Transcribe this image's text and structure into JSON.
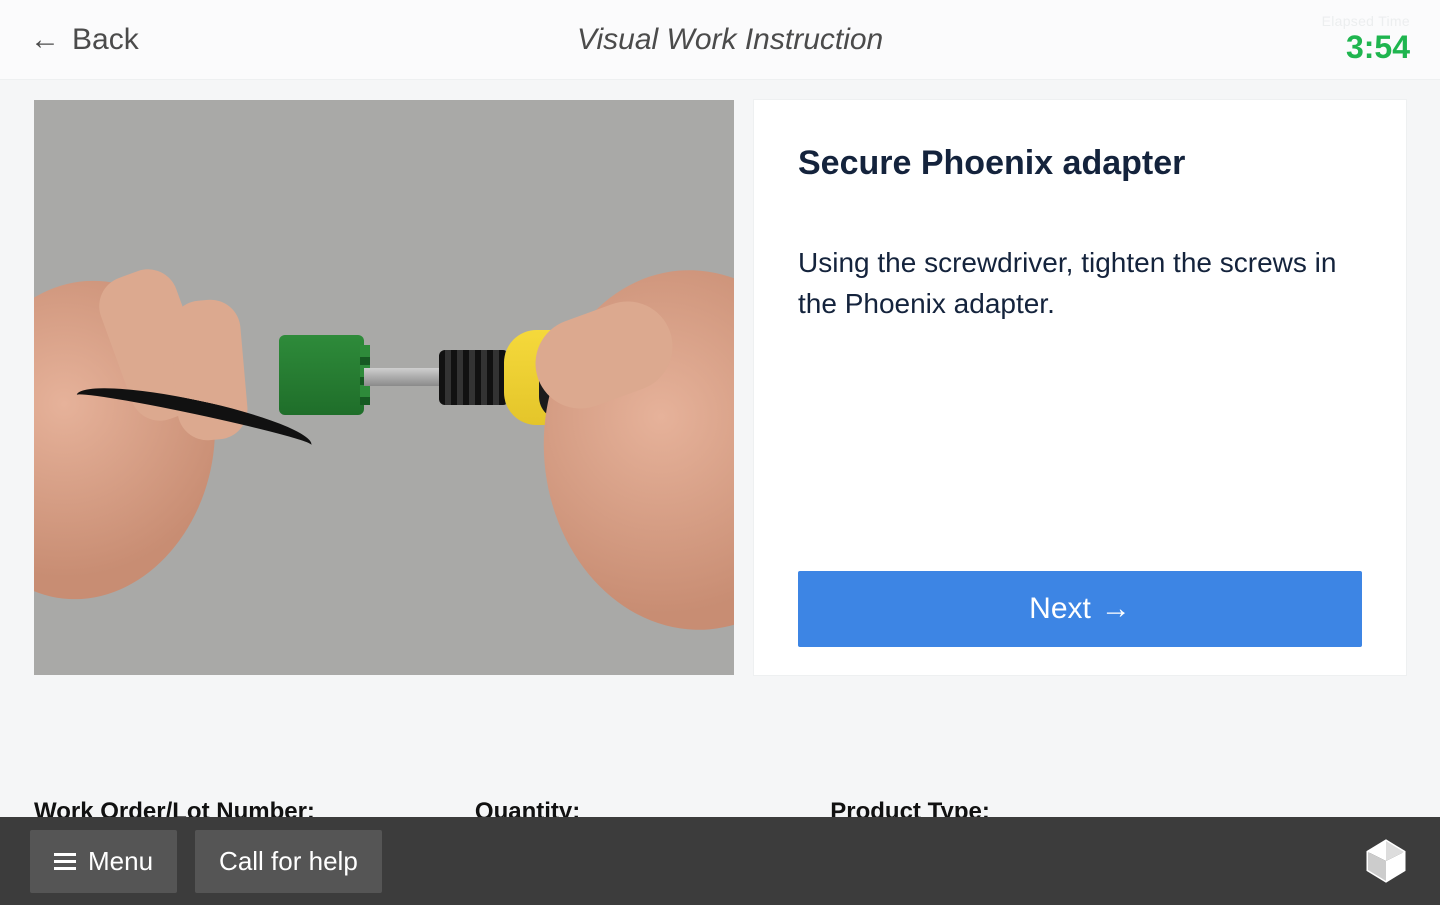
{
  "header": {
    "back_label": "Back",
    "title": "Visual Work Instruction",
    "timer_label": "Elapsed Time",
    "timer_value": "3:54"
  },
  "step": {
    "title": "Secure Phoenix adapter",
    "body": "Using the screwdriver, tighten the screws in the Phoenix adapter.",
    "next_label": "Next"
  },
  "meta": {
    "work_order_label": "Work Order/Lot Number:",
    "quantity_label": "Quantity:",
    "product_type_label": "Product Type:"
  },
  "footer": {
    "menu_label": "Menu",
    "help_label": "Call for help"
  }
}
